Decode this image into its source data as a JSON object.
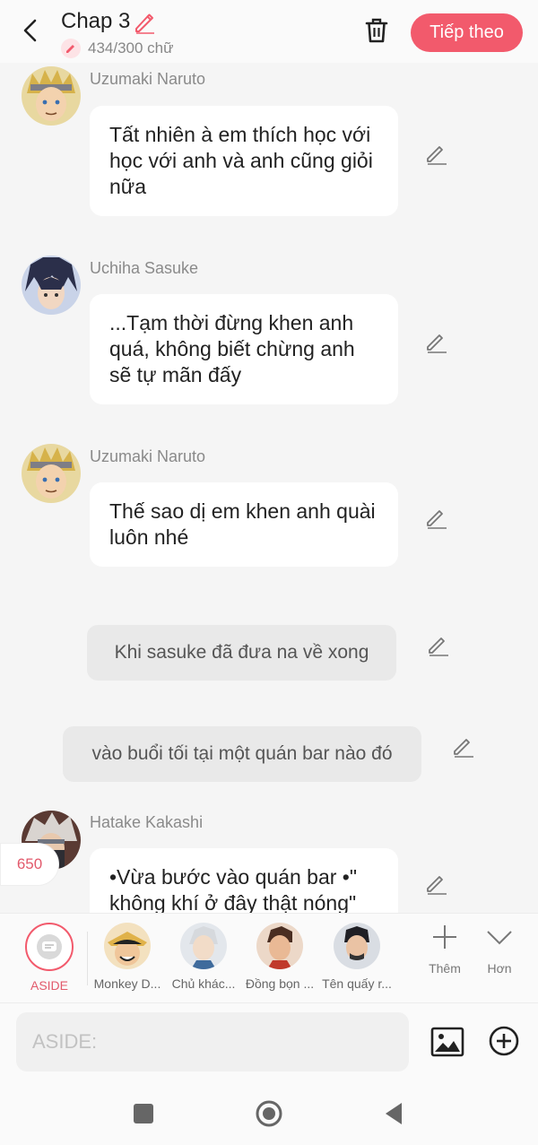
{
  "header": {
    "title": "Chap 3",
    "word_count": "434/300 chữ",
    "next_label": "Tiếp theo"
  },
  "messages": [
    {
      "type": "dialog",
      "name": "Uzumaki Naruto",
      "text": "Tất nhiên à em thích học với học với anh và anh cũng giỏi nữa"
    },
    {
      "type": "dialog",
      "name": "Uchiha Sasuke",
      "text": "...Tạm thời đừng khen anh quá, không biết chừng anh sẽ tự mãn đấy"
    },
    {
      "type": "dialog",
      "name": "Uzumaki Naruto",
      "text": "Thế sao dị em khen anh quài luôn nhé"
    },
    {
      "type": "aside",
      "text": "Khi sasuke đã đưa na về xong"
    },
    {
      "type": "aside",
      "text": "vào buổi tối tại một quán bar nào đó"
    },
    {
      "type": "dialog",
      "name": "Hatake Kakashi",
      "text": "•Vừa bước vào quán bar •\" không khí ở đây thật nóng\""
    }
  ],
  "message_count": "650",
  "characters": [
    {
      "label": "ASIDE",
      "icon": "aside-icon"
    },
    {
      "label": "Monkey D..."
    },
    {
      "label": "Chủ khác..."
    },
    {
      "label": "Đồng bọn ..."
    },
    {
      "label": "Tên quấy r..."
    }
  ],
  "tools": {
    "add_label": "Thêm",
    "more_label": "Hơn"
  },
  "input": {
    "placeholder": "ASIDE:"
  },
  "colors": {
    "accent": "#f25a6c",
    "background": "#f5f5f5",
    "bubble": "#ffffff",
    "aside_bubble": "#e9e9e9"
  }
}
